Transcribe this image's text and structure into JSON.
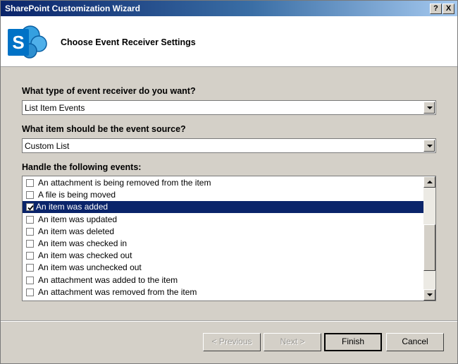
{
  "window": {
    "title": "SharePoint Customization Wizard",
    "help_label": "?",
    "close_label": "X"
  },
  "header": {
    "heading": "Choose Event Receiver Settings",
    "logo_letter": "S",
    "logo_color": "#0072c6"
  },
  "form": {
    "q1_label": "What type of event receiver do you want?",
    "q1_value": "List Item Events",
    "q2_label": "What item should be the event source?",
    "q2_value": "Custom List",
    "q3_label": "Handle the following events:"
  },
  "events": [
    {
      "label": "An attachment is being removed from the item",
      "checked": false,
      "selected": false
    },
    {
      "label": "A file is being moved",
      "checked": false,
      "selected": false
    },
    {
      "label": "An item was added",
      "checked": true,
      "selected": true
    },
    {
      "label": "An item was updated",
      "checked": false,
      "selected": false
    },
    {
      "label": "An item was deleted",
      "checked": false,
      "selected": false
    },
    {
      "label": "An item was checked in",
      "checked": false,
      "selected": false
    },
    {
      "label": "An item was checked out",
      "checked": false,
      "selected": false
    },
    {
      "label": "An item was unchecked out",
      "checked": false,
      "selected": false
    },
    {
      "label": "An attachment was added to the item",
      "checked": false,
      "selected": false
    },
    {
      "label": "An attachment was removed from the item",
      "checked": false,
      "selected": false
    }
  ],
  "buttons": {
    "previous": "< Previous",
    "next": "Next >",
    "finish": "Finish",
    "cancel": "Cancel"
  },
  "colors": {
    "selection": "#0a246a",
    "title_gradient_start": "#0a246a",
    "dialog_bg": "#d4d0c8"
  }
}
